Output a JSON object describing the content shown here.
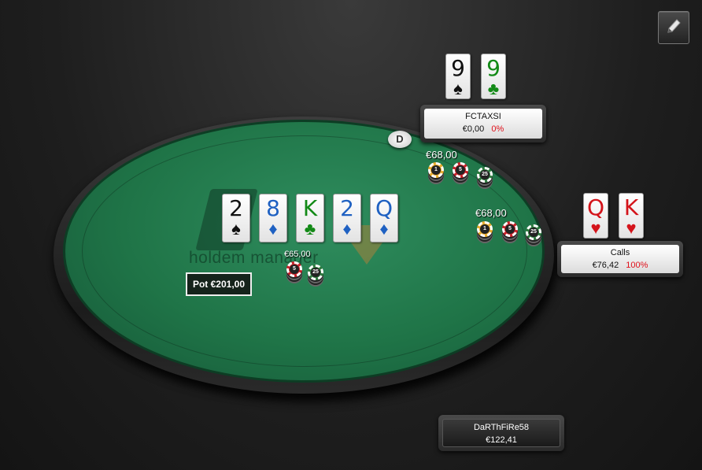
{
  "table": {
    "logo_text": "holdem manager"
  },
  "pot": {
    "label": "Pot €201,00"
  },
  "dealer_button": {
    "label": "D"
  },
  "board": [
    {
      "rank": "2",
      "suit": "♠",
      "color": "#111111"
    },
    {
      "rank": "8",
      "suit": "♦",
      "color": "#1f61c2"
    },
    {
      "rank": "K",
      "suit": "♣",
      "color": "#138a17"
    },
    {
      "rank": "2",
      "suit": "♦",
      "color": "#1f61c2"
    },
    {
      "rank": "Q",
      "suit": "♦",
      "color": "#1f61c2"
    }
  ],
  "players": {
    "top": {
      "name": "FCTAXSI",
      "stack": "€0,00",
      "equity": "0%",
      "cards": [
        {
          "rank": "9",
          "suit": "♠",
          "color": "#111111"
        },
        {
          "rank": "9",
          "suit": "♣",
          "color": "#138a17"
        }
      ],
      "bet": "€68,00"
    },
    "right": {
      "name": "Calls",
      "stack": "€76,42",
      "equity": "100%",
      "cards": [
        {
          "rank": "Q",
          "suit": "♥",
          "color": "#d4141b"
        },
        {
          "rank": "K",
          "suit": "♥",
          "color": "#d4141b"
        }
      ],
      "bet": "€68,00"
    },
    "bottom": {
      "name": "DaRThFiRe58",
      "stack": "€122,41",
      "bet": "€65,00"
    }
  },
  "chip_labels": {
    "one": "1",
    "five": "5",
    "twentyfive": "25"
  },
  "icons": {
    "edit": "pencil-icon"
  }
}
